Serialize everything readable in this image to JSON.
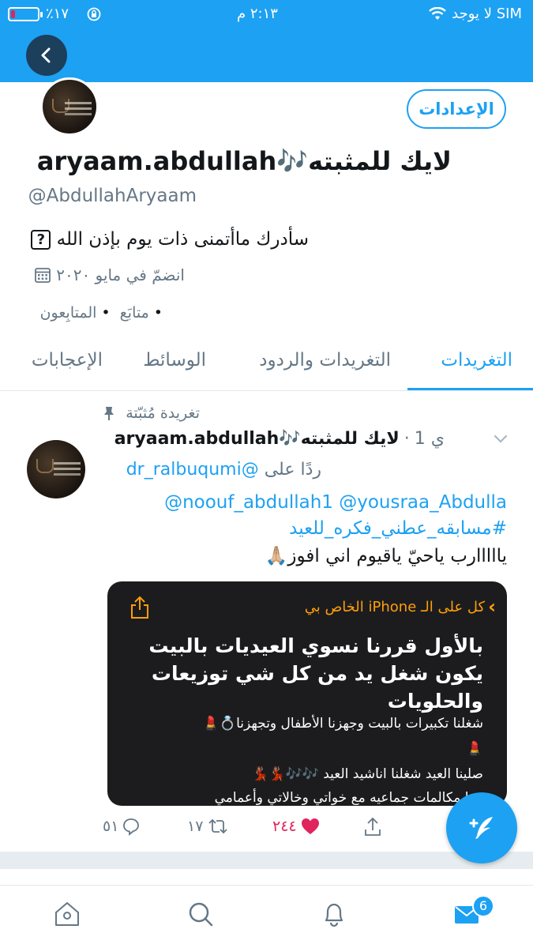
{
  "status_bar": {
    "carrier": "لا يوجد SIM",
    "time": "٢:١٣ م",
    "battery_percent": "٪١٧",
    "battery_level": 0.17
  },
  "profile": {
    "settings_label": "الإعدادات",
    "display_name": "aryaam.abdullah🎶لايك للمثبته",
    "handle": "@AbdullahAryaam",
    "bio": "سأدرك ماأتمنى ذات يوم بإذن الله",
    "bio_icon": "?",
    "joined": "انضمّ في مايو ٢٠٢٠",
    "following_label": "متابَع",
    "followers_label": "المتابِعون"
  },
  "tabs": [
    {
      "label": "التغريدات",
      "active": true
    },
    {
      "label": "التغريدات والردود",
      "active": false
    },
    {
      "label": "الوسائط",
      "active": false
    },
    {
      "label": "الإعجابات",
      "active": false
    }
  ],
  "tweet": {
    "pinned_label": "تغريدة مُثبّتة",
    "name": "aryaam.abdullah🎶لايك للمثبته",
    "time": "1 ي",
    "reply_prefix": "ردًا على",
    "reply_handle": "@dr_ralbuqumi",
    "mentions": "@noouf_abdullah1 @yousraa_Abdulla",
    "hashtag": "#مسابقه_عطني_فكره_للعيد",
    "text": "يااااارب ياحيّ ياقيوم اني افوز🙏🏼",
    "media": {
      "back_label": "كل على الـ iPhone الخاص بي",
      "title": "بالأول قررنا نسوي العيديات بالبيت يكون شغل يد من كل شي توزيعات والحلويات",
      "line1": "شغلنا تكبيرات بالبيت وجهزنا الأطفال وتجهزنا💍💄",
      "line2": "💄",
      "line3": "صلينا العيد شغلنا اناشيد العيد 🎶🎶💃🏽💃🏽",
      "line4": "وبنا مكالمات جماعيه مع خواتي وخالاتي وأعمامي"
    },
    "replies": "٥١",
    "retweets": "١٧",
    "likes": "٢٤٤"
  },
  "tab_bar": {
    "messages_badge": "6"
  },
  "colors": {
    "accent": "#1da1f2",
    "like": "#e0245e",
    "secondary_text": "#657786"
  }
}
